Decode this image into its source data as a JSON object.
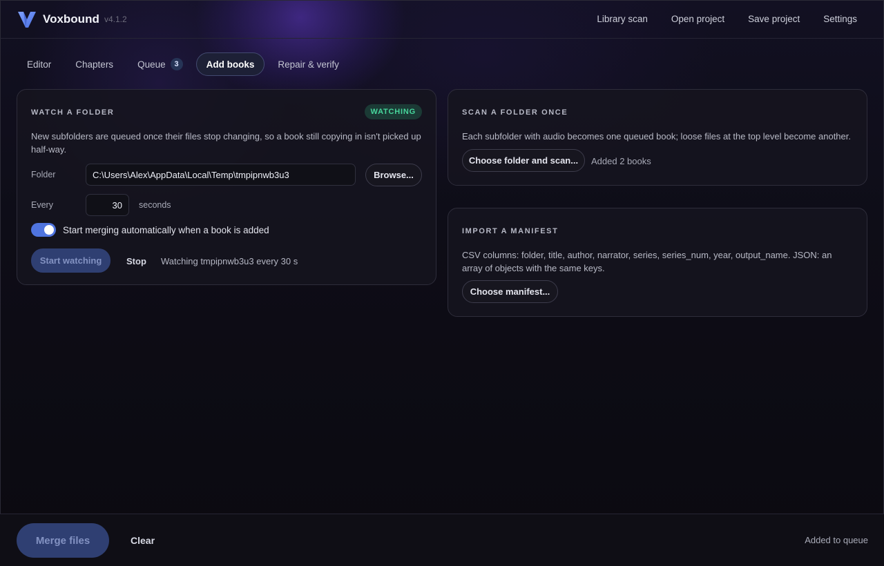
{
  "app": {
    "name": "Voxbound",
    "version": "v4.1.2",
    "accent_color": "#4f74df",
    "success_color": "#47d69c"
  },
  "top_nav": [
    {
      "label": "Library scan"
    },
    {
      "label": "Open project"
    },
    {
      "label": "Save project"
    },
    {
      "label": "Settings"
    }
  ],
  "tabs": [
    {
      "label": "Editor",
      "active": false
    },
    {
      "label": "Chapters",
      "active": false
    },
    {
      "label": "Queue",
      "badge": "3",
      "active": false
    },
    {
      "label": "Add books",
      "active": true
    },
    {
      "label": "Repair & verify",
      "active": false
    }
  ],
  "watch_folder": {
    "title": "WATCH A FOLDER",
    "status": "WATCHING",
    "description": "New subfolders are queued once their files stop changing, so a book still copying in isn't picked up half-way.",
    "folder_label": "Folder",
    "folder_value": "C:\\Users\\Alex\\AppData\\Local\\Temp\\tmpipnwb3u3",
    "browse_label": "Browse...",
    "every_label": "Every",
    "every_value": "30",
    "every_unit": "seconds",
    "auto_merge_label": "Start merging automatically when a book is added",
    "auto_merge_on": true,
    "start_label": "Start watching",
    "stop_label": "Stop",
    "status_text": "Watching tmpipnwb3u3 every 30 s"
  },
  "scan_once": {
    "title": "SCAN A FOLDER ONCE",
    "description": "Each subfolder with audio becomes one queued book; loose files at the top level become another.",
    "button_label": "Choose folder and scan...",
    "result_text": "Added 2 books"
  },
  "manifest": {
    "title": "IMPORT A MANIFEST",
    "description": "CSV columns: folder, title, author, narrator, series, series_num, year, output_name. JSON: an array of objects with the same keys.",
    "button_label": "Choose manifest..."
  },
  "footer": {
    "merge_label": "Merge files",
    "clear_label": "Clear",
    "status_text": "Added to queue"
  }
}
